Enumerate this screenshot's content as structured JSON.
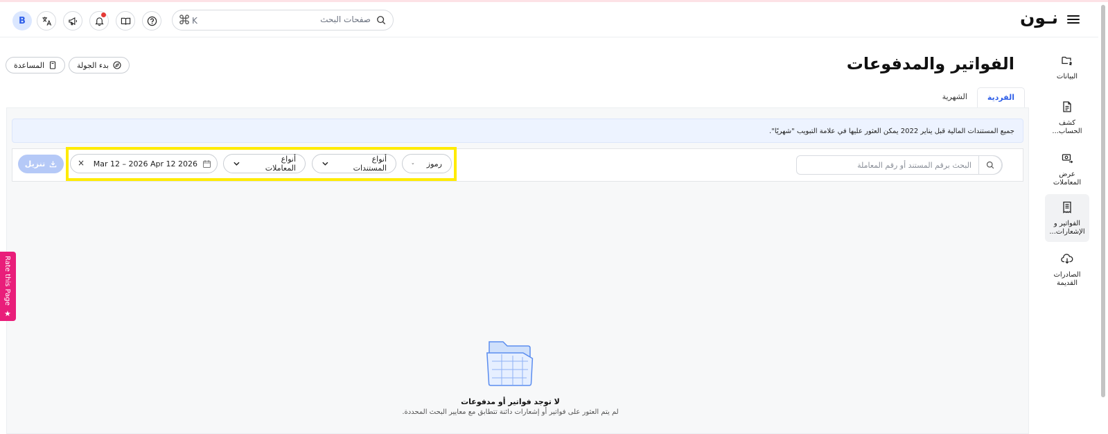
{
  "topbar": {
    "logo": "نـون",
    "search_placeholder": "صفحات البحث",
    "shortcut_key": "K",
    "avatar_letter": "B"
  },
  "sidebar": {
    "items": [
      {
        "label": "البيانات"
      },
      {
        "label": "كشف الحساب..."
      },
      {
        "label": "عرض المعاملات"
      },
      {
        "label": "الفواتير و الإشعارات..."
      },
      {
        "label": "الصادرات القديمة"
      }
    ]
  },
  "header": {
    "title": "الفواتير والمدفوعات",
    "tour_label": "بدء الجولة",
    "help_label": "المساعدة"
  },
  "tabs": [
    {
      "label": "الفردية",
      "active": true
    },
    {
      "label": "الشهرية",
      "active": false
    }
  ],
  "banner": {
    "text": "جميع المستندات المالية قبل يناير 2022 يمكن العثور عليها في علامة التبويب \"شهريًا\"."
  },
  "filters": {
    "search_placeholder": "البحث برقم المستند أو رقم المعاملة",
    "codes_label": "رموز",
    "doc_types_label": "أنواع المستندات",
    "txn_types_label": "أنواع المعاملات",
    "date_range": "Mar 12 – 2026 Apr 12 2026",
    "clear": "×",
    "download_label": "تنزيل"
  },
  "empty_state": {
    "title": "لا توجد فواتير أو مدفوعات",
    "subtitle": "لم يتم العثور على فواتير أو إشعارات دائنة تتطابق مع معايير البحث المحددة."
  },
  "rate_tab": {
    "label": "Rate this Page",
    "star": "★"
  },
  "colors": {
    "accent": "#2f5fe8",
    "highlight": "#ffeb00",
    "rate_tab": "#e91e7a"
  }
}
